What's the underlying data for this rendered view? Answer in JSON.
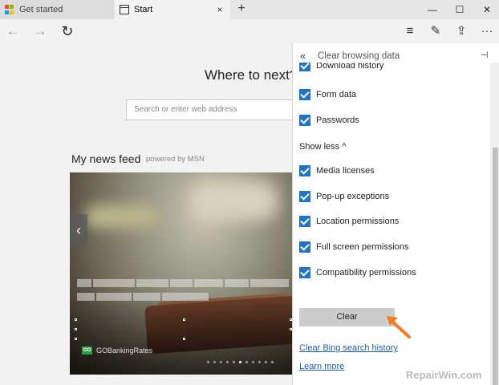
{
  "tabs": [
    {
      "label": "Get started",
      "icon": "windows-logo-icon",
      "close": "×"
    },
    {
      "label": "Start",
      "icon": "start-page-icon",
      "close": "×"
    }
  ],
  "new_tab": "+",
  "window_controls": {
    "minimize": "—",
    "maximize": "☐",
    "close": "✕"
  },
  "nav": {
    "back": "←",
    "forward": "→",
    "refresh": "↻"
  },
  "toolbar": {
    "hub": "≡",
    "notes": "✎",
    "share": "⇪",
    "more": "···"
  },
  "page": {
    "heading": "Where to next?",
    "search_placeholder": "Search or enter web address",
    "feed_title": "My news feed",
    "powered_by": "powered by MSN",
    "news_source": "GOBankingRates",
    "news_source_logo": "GO",
    "prev": "‹"
  },
  "panel": {
    "back": "«",
    "title": "Clear browsing data",
    "pin": "⊣",
    "items_top": [
      {
        "label": "Download history",
        "checked": true
      },
      {
        "label": "Form data",
        "checked": true
      },
      {
        "label": "Passwords",
        "checked": true
      }
    ],
    "show_less": "Show less ^",
    "items_more": [
      {
        "label": "Media licenses",
        "checked": true
      },
      {
        "label": "Pop-up exceptions",
        "checked": true
      },
      {
        "label": "Location permissions",
        "checked": true
      },
      {
        "label": "Full screen permissions",
        "checked": true
      },
      {
        "label": "Compatibility permissions",
        "checked": true
      }
    ],
    "clear_button": "Clear",
    "bing_link": "Clear Bing search history",
    "learn_more": "Learn more"
  },
  "watermark": "RepairWin.com",
  "colors": {
    "checkbox": "#1e74c8",
    "link": "#1a5fb4",
    "annotation_arrow": "#f07b22"
  }
}
